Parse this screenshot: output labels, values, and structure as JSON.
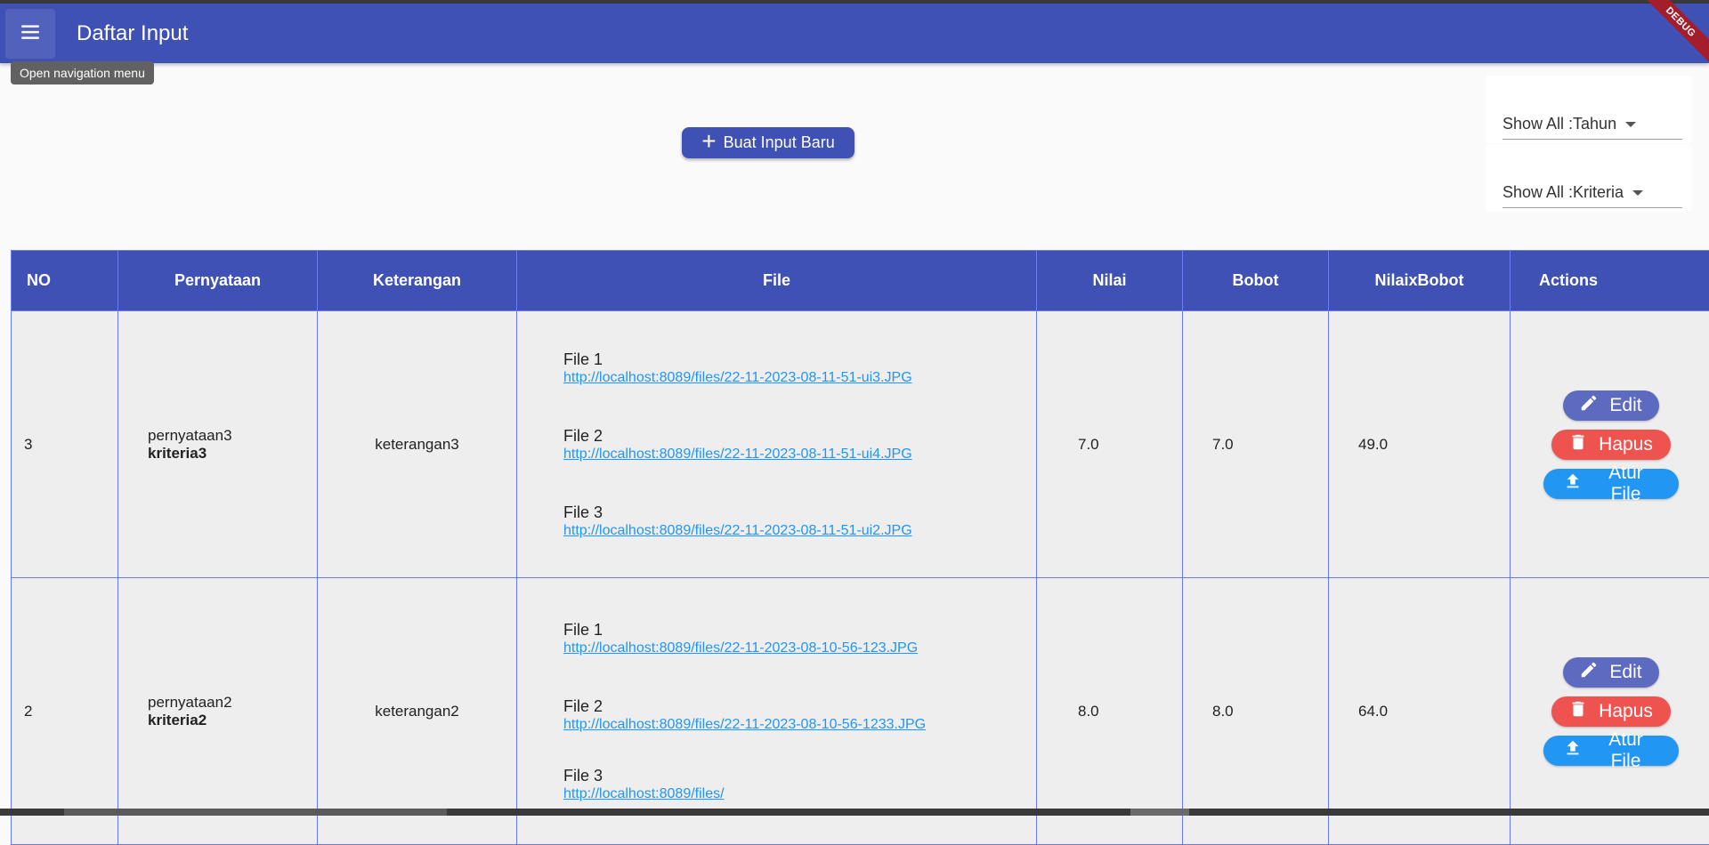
{
  "appbar": {
    "title": "Daftar Input",
    "menu_icon": "menu-icon",
    "tooltip": "Open navigation menu",
    "debug_banner": "DEBUG",
    "color": "#3f51b5"
  },
  "create_button": {
    "icon": "plus-icon",
    "label": "Buat Input Baru"
  },
  "filters": {
    "year": {
      "value": "Show All :Tahun"
    },
    "criteria": {
      "value": "Show All :Kriteria"
    }
  },
  "table": {
    "headers": [
      "NO",
      "Pernyataan",
      "Keterangan",
      "File",
      "Nilai",
      "Bobot",
      "NilaixBobot",
      "Actions"
    ],
    "rows": [
      {
        "no": "3",
        "pernyataan": "pernyataan3",
        "kriteria": "kriteria3",
        "keterangan": "keterangan3",
        "files": [
          {
            "label": "File 1",
            "url": "http://localhost:8089/files/22-11-2023-08-11-51-ui3.JPG"
          },
          {
            "label": "File 2",
            "url": "http://localhost:8089/files/22-11-2023-08-11-51-ui4.JPG"
          },
          {
            "label": "File 3",
            "url": "http://localhost:8089/files/22-11-2023-08-11-51-ui2.JPG"
          }
        ],
        "nilai": "7.0",
        "bobot": "7.0",
        "nilaixbobot": "49.0"
      },
      {
        "no": "2",
        "pernyataan": "pernyataan2",
        "kriteria": "kriteria2",
        "keterangan": "keterangan2",
        "files": [
          {
            "label": "File 1",
            "url": "http://localhost:8089/files/22-11-2023-08-10-56-123.JPG"
          },
          {
            "label": "File 2",
            "url": "http://localhost:8089/files/22-11-2023-08-10-56-1233.JPG"
          },
          {
            "label": "File 3",
            "url": "http://localhost:8089/files/"
          }
        ],
        "nilai": "8.0",
        "bobot": "8.0",
        "nilaixbobot": "64.0"
      }
    ],
    "actions": {
      "edit": {
        "label": "Edit",
        "icon": "pencil-icon",
        "color": "#5c6bc0"
      },
      "hapus": {
        "label": "Hapus",
        "icon": "trash-icon",
        "color": "#ef5350"
      },
      "atur": {
        "label": "Atur File",
        "icon": "upload-icon",
        "color": "#2196f3"
      }
    }
  }
}
